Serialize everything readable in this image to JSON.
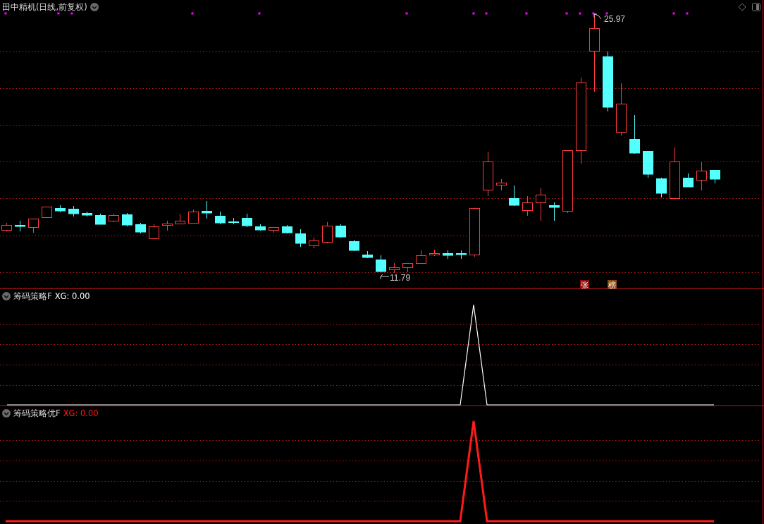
{
  "main_chart": {
    "title": "田中精机(日线,前复权)",
    "high_label": "25.97",
    "low_label": "11.79",
    "badges": [
      {
        "text": "张",
        "color": "#8b0a0a"
      },
      {
        "text": "榜",
        "color": "#8b4a14"
      }
    ]
  },
  "indicators": [
    {
      "name": "筹码策略F",
      "reading": "XG: 0.00",
      "kind": "thin",
      "color": "#ffffff"
    },
    {
      "name": "筹码策略优F",
      "reading": "XG: 0.00",
      "kind": "thick",
      "color": "#ff1a1a"
    }
  ]
}
